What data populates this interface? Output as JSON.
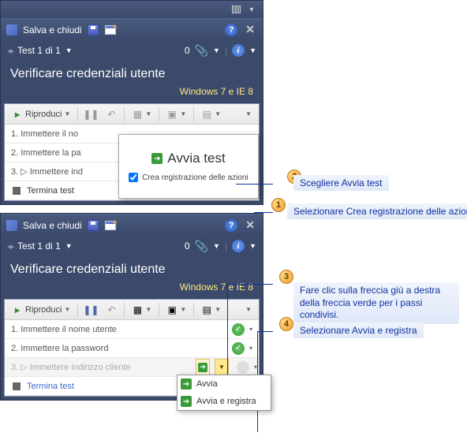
{
  "titlebar": {
    "save_close": "Salva e chiudi"
  },
  "nav": {
    "test_counter": "Test 1 di 1",
    "attach_count": "0"
  },
  "heading": "Verificare credenziali utente",
  "subheading": "Windows 7 e IE 8",
  "toolbar": {
    "play": "Riproduci"
  },
  "steps_short": {
    "s1": "1. Immettere il no",
    "s2": "2. Immettere la pa",
    "s3": "3. ▷ Immettere ind",
    "term": "Termina test"
  },
  "steps_full": {
    "s1": "1. Immettere il nome utente",
    "s2": "2. Immettere la password",
    "s3": "3. ▷  Immettere indirizzo cliente",
    "term": "Termina test"
  },
  "popup": {
    "title": "Avvia test",
    "checkbox": "Crea registrazione delle azioni"
  },
  "menu": {
    "start": "Avvia",
    "start_record": "Avvia e registra"
  },
  "callouts": {
    "c1": "Selezionare Crea registrazione delle azioni",
    "c2": "Scegliere Avvia test",
    "c3": "Fare clic sulla freccia giù a destra della freccia verde per i passi condivisi.",
    "c4": "Selezionare Avvia e registra"
  }
}
